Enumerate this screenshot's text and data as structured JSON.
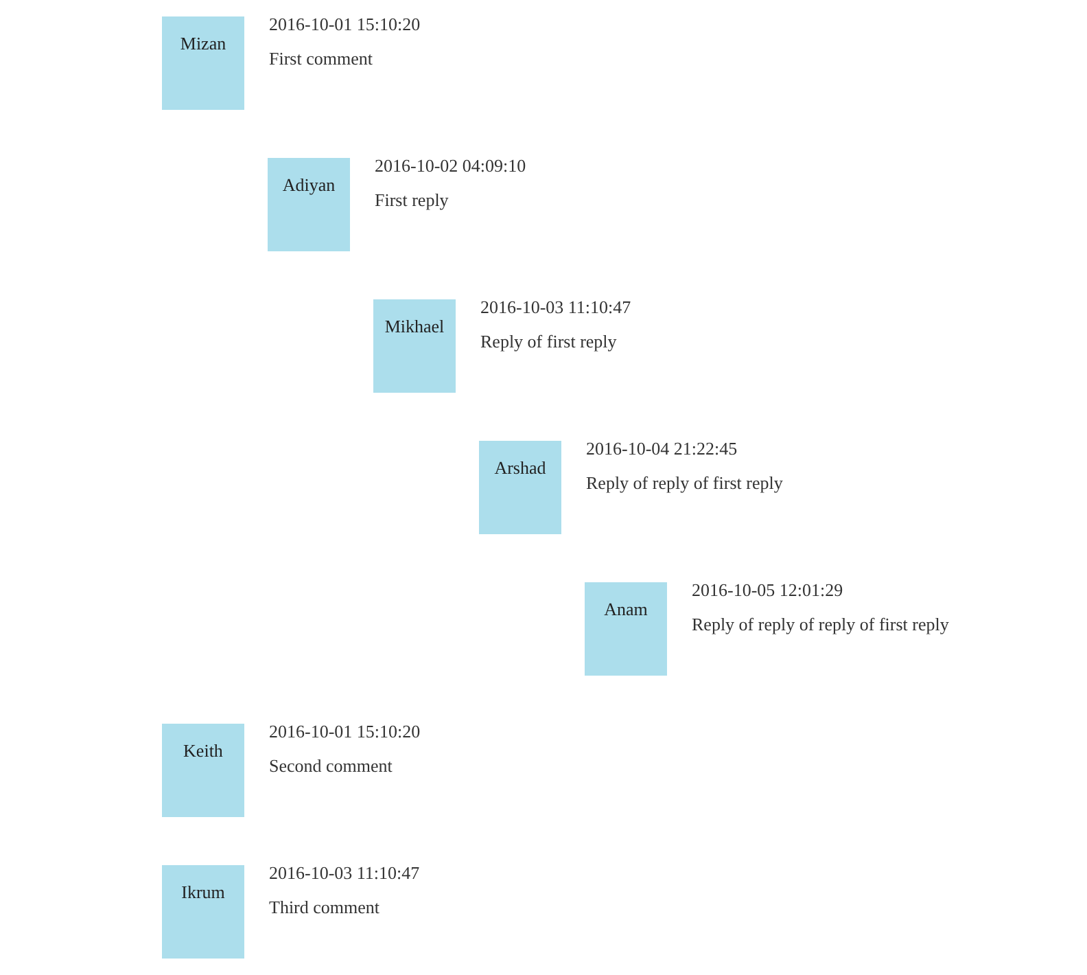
{
  "comments": [
    {
      "author": "Mizan",
      "date": "2016-10-01 15:10:20",
      "text": "First comment",
      "children": [
        {
          "author": "Adiyan",
          "date": "2016-10-02 04:09:10",
          "text": "First reply",
          "children": [
            {
              "author": "Mikhael",
              "date": "2016-10-03 11:10:47",
              "text": "Reply of first reply",
              "children": [
                {
                  "author": "Arshad",
                  "date": "2016-10-04 21:22:45",
                  "text": "Reply of reply of first reply",
                  "children": [
                    {
                      "author": "Anam",
                      "date": "2016-10-05 12:01:29",
                      "text": "Reply of reply of reply of first reply"
                    }
                  ]
                }
              ]
            }
          ]
        }
      ]
    },
    {
      "author": "Keith",
      "date": "2016-10-01 15:10:20",
      "text": "Second comment"
    },
    {
      "author": "Ikrum",
      "date": "2016-10-03 11:10:47",
      "text": "Third comment"
    }
  ]
}
